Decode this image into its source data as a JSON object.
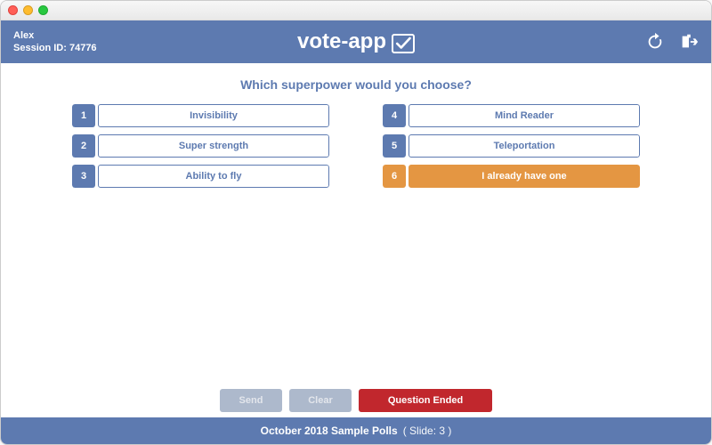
{
  "colors": {
    "primary": "#5d7ab0",
    "selected": "#e49642",
    "danger": "#c1272d"
  },
  "user": {
    "name": "Alex",
    "session_label": "Session ID: 74776"
  },
  "brand": {
    "name": "vote-app"
  },
  "question": "Which superpower would you choose?",
  "options": [
    {
      "n": "1",
      "label": "Invisibility"
    },
    {
      "n": "2",
      "label": "Super strength"
    },
    {
      "n": "3",
      "label": "Ability to fly"
    },
    {
      "n": "4",
      "label": "Mind Reader"
    },
    {
      "n": "5",
      "label": "Teleportation"
    },
    {
      "n": "6",
      "label": "I already have one"
    }
  ],
  "selected_index": 5,
  "actions": {
    "send": "Send",
    "clear": "Clear",
    "status": "Question Ended"
  },
  "footer": {
    "title": "October 2018 Sample Polls",
    "slide": "( Slide: 3 )"
  }
}
